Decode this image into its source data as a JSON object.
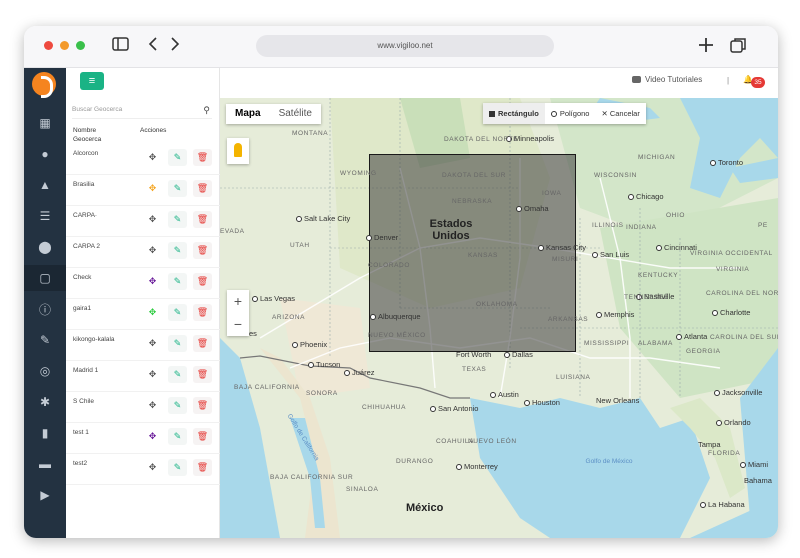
{
  "browser": {
    "url": "www.vigiloo.net"
  },
  "topbar": {
    "tutorials_label": "Video Tutoriales",
    "separator": "|",
    "notification_count": "35"
  },
  "panel": {
    "search_placeholder": "Buscar Geocerca",
    "col_name": "Nombre Geocerca",
    "col_actions": "Acciones",
    "rows": [
      {
        "name": "Alcorcon",
        "move_color": "#555555"
      },
      {
        "name": "Brasilia",
        "move_color": "#f5a623"
      },
      {
        "name": "CARPA·",
        "move_color": "#555555"
      },
      {
        "name": "CARPA 2",
        "move_color": "#555555"
      },
      {
        "name": "Check",
        "move_color": "#6a1b9a"
      },
      {
        "name": "gaira1",
        "move_color": "#2ecc40"
      },
      {
        "name": "kikongo-kalala",
        "move_color": "#555555"
      },
      {
        "name": "Madrid 1",
        "move_color": "#555555"
      },
      {
        "name": "S Chile",
        "move_color": "#555555"
      },
      {
        "name": "test 1",
        "move_color": "#6a1b9a"
      },
      {
        "name": "test2",
        "move_color": "#555555"
      }
    ]
  },
  "map": {
    "type_map": "Mapa",
    "type_satellite": "Satélite",
    "draw_rectangle": "Rectángulo",
    "draw_polygon": "Polígono",
    "draw_cancel": "Cancelar",
    "zoom_in": "+",
    "zoom_out": "−",
    "labels": {
      "minneapolis": "Minneapolis",
      "toronto": "Toronto",
      "chicago": "Chicago",
      "cincinnati": "Cincinnati",
      "stlouis": "San Luis",
      "kansascity": "Kansas City",
      "omaha": "Omaha",
      "denver": "Denver",
      "saltlake": "Salt Lake City",
      "lasvegas": "Las Vegas",
      "phoenix": "Phoenix",
      "tucson": "Tucson",
      "albuquerque": "Albuquerque",
      "juarez": "Juárez",
      "dallas": "Dallas",
      "fortworth": "Fort Worth",
      "austin": "Austin",
      "sanantonio": "San Antonio",
      "houston": "Houston",
      "neworleans": "New Orleans",
      "memphis": "Memphis",
      "nashville": "Nashville",
      "atlanta": "Atlanta",
      "charlotte": "Charlotte",
      "jacksonville": "Jacksonville",
      "orlando": "Orlando",
      "tampa": "Tampa",
      "miami": "Miami",
      "monterrey": "Monterrey",
      "mexico": "México",
      "habana": "La Habana",
      "bahamas": "Bahama",
      "usa": "Estados Unidos",
      "gulf": "Golfo de México",
      "gulf_california": "Golfo de California",
      "montana": "MONTANA",
      "dakota_n": "DAKOTA DEL NORTE",
      "dakota_s": "DAKOTA DEL SUR",
      "wyoming": "WYOMING",
      "nebraska": "NEBRASKA",
      "iowa": "IOWA",
      "kansas": "KANSAS",
      "colorado": "COLORADO",
      "utah": "UTAH",
      "nevada": "EVADA",
      "misuri": "MISURI",
      "oklahoma": "OKLAHOMA",
      "arkansas": "ARKANSAS",
      "nuevo_mexico": "NUEVO MÉXICO",
      "arizona": "ARIZONA",
      "texas": "TEXAS",
      "sonora": "SONORA",
      "chihuahua": "CHIHUAHUA",
      "coahuila": "COAHUILA",
      "durango": "DURANGO",
      "baja": "BAJA CALIFORNIA",
      "baja_sur": "BAJA CALIFORNIA SUR",
      "sinaloa": "SINALOA",
      "nuevo_leon": "NUEVO LEÓN",
      "illinois": "ILLINOIS",
      "indiana": "INDIANA",
      "ohio": "OHIO",
      "kentucky": "KENTUCKY",
      "tennessee": "TENNESSEE",
      "mississippi": "MISSISSIPPI",
      "alabama": "ALABAMA",
      "georgia": "GEORGIA",
      "carolina_s": "CAROLINA DEL SUR",
      "carolina_n": "CAROLINA DEL NORTE",
      "virginia": "VIRGINIA",
      "virginia_o": "VIRGINIA OCCIDENTAL",
      "michigan": "MICHIGAN",
      "wisconsin": "WISCONSIN",
      "luisiana": "LUISIANA",
      "florida": "FLORIDA",
      "pennsylvania": "PE",
      "es_partial": "es"
    }
  }
}
